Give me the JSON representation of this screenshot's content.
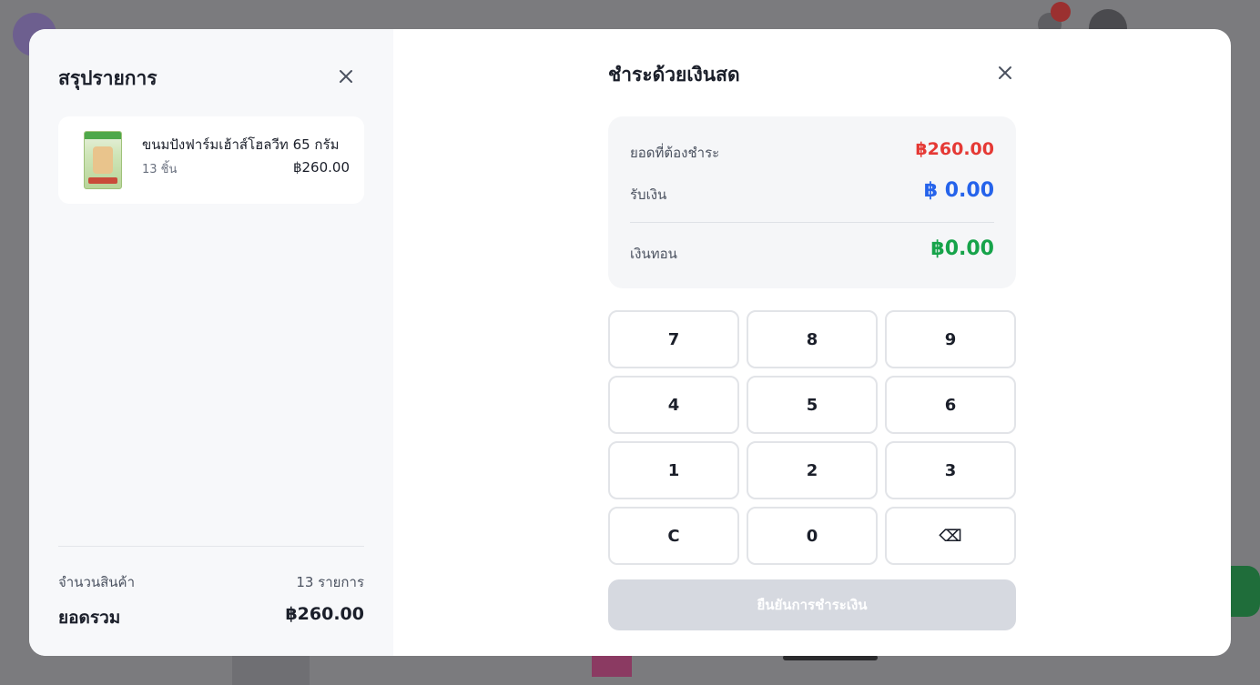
{
  "summary": {
    "title": "สรุปรายการ",
    "item": {
      "name": "ขนมปังฟาร์มเฮ้าส์โฮลวีท 65 กรัม",
      "qty": "13 ชิ้น",
      "price": "฿260.00"
    },
    "count_label": "จำนวนสินค้า",
    "count_value": "13 รายการ",
    "total_label": "ยอดรวม",
    "total_value": "฿260.00"
  },
  "payment": {
    "title": "ชำระด้วยเงินสด",
    "due_label": "ยอดที่ต้องชำระ",
    "due_value": "฿260.00",
    "received_label": "รับเงิน",
    "received_value": "฿ 0.00",
    "change_label": "เงินทอน",
    "change_value": "฿0.00",
    "keys": [
      "7",
      "8",
      "9",
      "4",
      "5",
      "6",
      "1",
      "2",
      "3",
      "C",
      "0",
      "⌫"
    ],
    "confirm_label": "ยืนยันการชำระเงิน"
  },
  "colors": {
    "due": "#e53935",
    "received": "#2563eb",
    "change": "#16a34a",
    "confirm_disabled": "#d6d9e0"
  },
  "icons": {
    "close": "close-icon",
    "backspace": "backspace-icon"
  }
}
